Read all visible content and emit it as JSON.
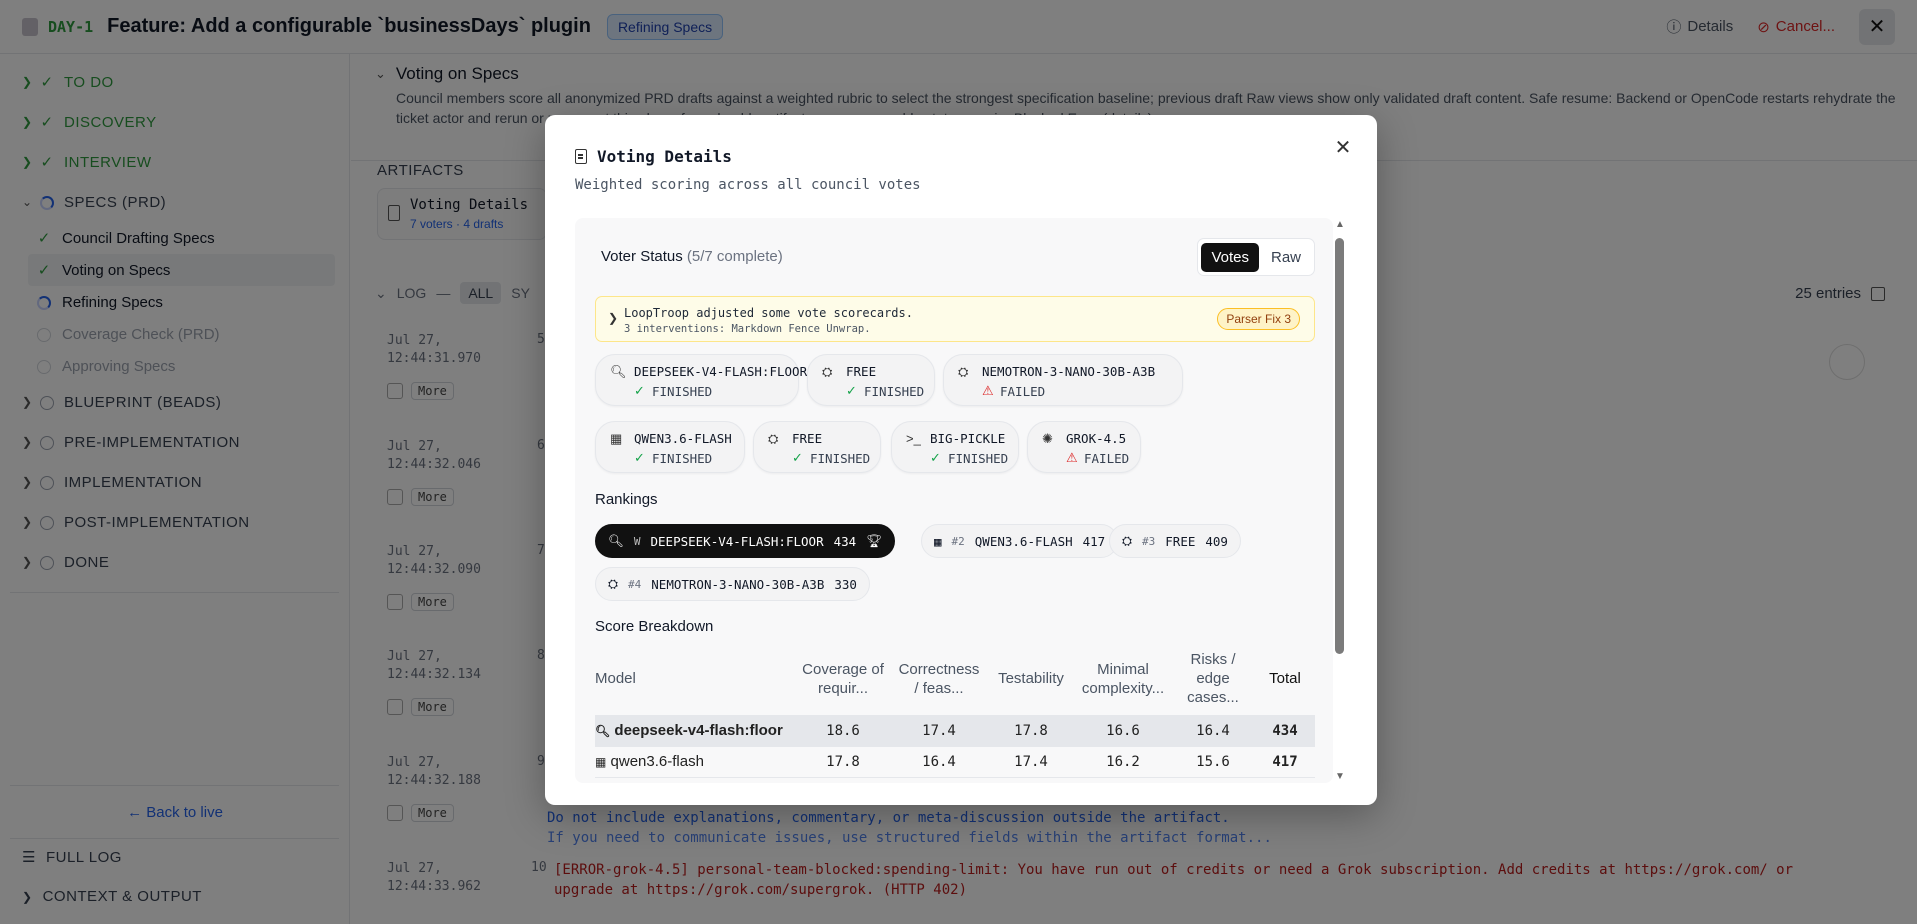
{
  "header": {
    "ticket_id": "DAY-1",
    "title": "Feature: Add a configurable `businessDays` plugin",
    "status_badge": "Refining Specs",
    "details_label": "Details",
    "cancel_label": "Cancel..."
  },
  "sidebar": {
    "phases": [
      {
        "label": "TO DO",
        "state": "done"
      },
      {
        "label": "DISCOVERY",
        "state": "done"
      },
      {
        "label": "INTERVIEW",
        "state": "done"
      },
      {
        "label": "SPECS (PRD)",
        "state": "active"
      }
    ],
    "subitems": [
      {
        "label": "Council Drafting Specs",
        "state": "done"
      },
      {
        "label": "Voting on Specs",
        "state": "done"
      },
      {
        "label": "Refining Specs",
        "state": "active"
      },
      {
        "label": "Coverage Check (PRD)",
        "state": "pending"
      },
      {
        "label": "Approving Specs",
        "state": "pending"
      }
    ],
    "later_phases": [
      {
        "label": "BLUEPRINT (BEADS)"
      },
      {
        "label": "PRE-IMPLEMENTATION"
      },
      {
        "label": "IMPLEMENTATION"
      },
      {
        "label": "POST-IMPLEMENTATION"
      },
      {
        "label": "DONE"
      }
    ],
    "back_to_live": "← Back to live",
    "full_log": "FULL LOG",
    "context_output": "CONTEXT & OUTPUT"
  },
  "main": {
    "section_title": "Voting on Specs",
    "section_desc": "Council members score all anonymized PRD drafts against a weighted rubric to select the strongest specification baseline; previous draft Raw views show only validated draft content. Safe resume: Backend or OpenCode restarts rehydrate the ticket actor and rerun or reconnect this phase from durable artifacts; non-recoverable states require Blocked Error (details).",
    "artifacts_label": "ARTIFACTS",
    "artifact": {
      "title": "Voting Details",
      "sub": "7 voters · 4 drafts"
    },
    "log": {
      "label": "LOG",
      "dash": "—",
      "all": "ALL",
      "sys": "SY",
      "entries": "25 entries"
    },
    "log_rows": [
      {
        "ts1": "Jul 27,",
        "ts2": "12:44:31.970",
        "num": "5",
        "more": "More"
      },
      {
        "ts1": "Jul 27,",
        "ts2": "12:44:32.046",
        "num": "6",
        "more": "More"
      },
      {
        "ts1": "Jul 27,",
        "ts2": "12:44:32.090",
        "num": "7",
        "more": "More"
      },
      {
        "ts1": "Jul 27,",
        "ts2": "12:44:32.134",
        "num": "8",
        "more": "More"
      },
      {
        "ts1": "Jul 27,",
        "ts2": "12:44:32.188",
        "num": "9",
        "more": "More"
      }
    ],
    "log_blue_1": "Do not include explanations, commentary, or meta-discussion outside the artifact.",
    "log_blue_2": "If you need to communicate issues, use structured fields within the artifact format...",
    "log_last": {
      "ts1": "Jul 27,",
      "ts2": "12:44:33.962",
      "num": "10"
    },
    "log_error": "[ERROR-grok-4.5] personal-team-blocked:spending-limit: You have run out of credits or need a Grok subscription. Add credits at https://grok.com/ or upgrade at https://grok.com/supergrok. (HTTP 402)"
  },
  "modal": {
    "title": "Voting Details",
    "subtitle": "Weighted scoring across all council votes",
    "voter_status": "Voter Status",
    "voter_count": "(5/7 complete)",
    "tab_votes": "Votes",
    "tab_raw": "Raw",
    "notice_line1": "LoopTroop adjusted some vote scorecards.",
    "notice_line2": "3 interventions: Markdown Fence Unwrap.",
    "notice_badge": "Parser Fix 3",
    "voters": [
      {
        "name": "DEEPSEEK-V4-FLASH:FLOOR",
        "status": "FINISHED",
        "icon": "magnifier-icon",
        "ok": true
      },
      {
        "name": "FREE",
        "status": "FINISHED",
        "icon": "robot-icon",
        "ok": true
      },
      {
        "name": "NEMOTRON-3-NANO-30B-A3B",
        "status": "FAILED",
        "icon": "robot-icon",
        "ok": false
      },
      {
        "name": "QWEN3.6-FLASH",
        "status": "FINISHED",
        "icon": "grid-icon",
        "ok": true
      },
      {
        "name": "FREE",
        "status": "FINISHED",
        "icon": "robot-icon",
        "ok": true
      },
      {
        "name": "BIG-PICKLE",
        "status": "FINISHED",
        "icon": "terminal-icon",
        "ok": true
      },
      {
        "name": "GROK-4.5",
        "status": "FAILED",
        "icon": "swirl-icon",
        "ok": false
      }
    ],
    "rankings_label": "Rankings",
    "rankings": [
      {
        "pos": "W",
        "name": "DEEPSEEK-V4-FLASH:FLOOR",
        "score": "434"
      },
      {
        "pos": "#2",
        "name": "QWEN3.6-FLASH",
        "score": "417"
      },
      {
        "pos": "#3",
        "name": "FREE",
        "score": "409"
      },
      {
        "pos": "#4",
        "name": "NEMOTRON-3-NANO-30B-A3B",
        "score": "330"
      }
    ],
    "score_breakdown_label": "Score Breakdown",
    "table": {
      "h_model": "Model",
      "h_cov": "Coverage of requir...",
      "h_corr": "Correctness / feas...",
      "h_test": "Testability",
      "h_min": "Minimal complexity...",
      "h_risk": "Risks / edge cases...",
      "h_total": "Total",
      "rows": [
        {
          "model": "deepseek-v4-flash:floor",
          "cov": "18.6",
          "corr": "17.4",
          "test": "17.8",
          "min": "16.6",
          "risk": "16.4",
          "total": "434"
        },
        {
          "model": "qwen3.6-flash",
          "cov": "17.8",
          "corr": "16.4",
          "test": "17.4",
          "min": "16.2",
          "risk": "15.6",
          "total": "417"
        }
      ]
    }
  }
}
